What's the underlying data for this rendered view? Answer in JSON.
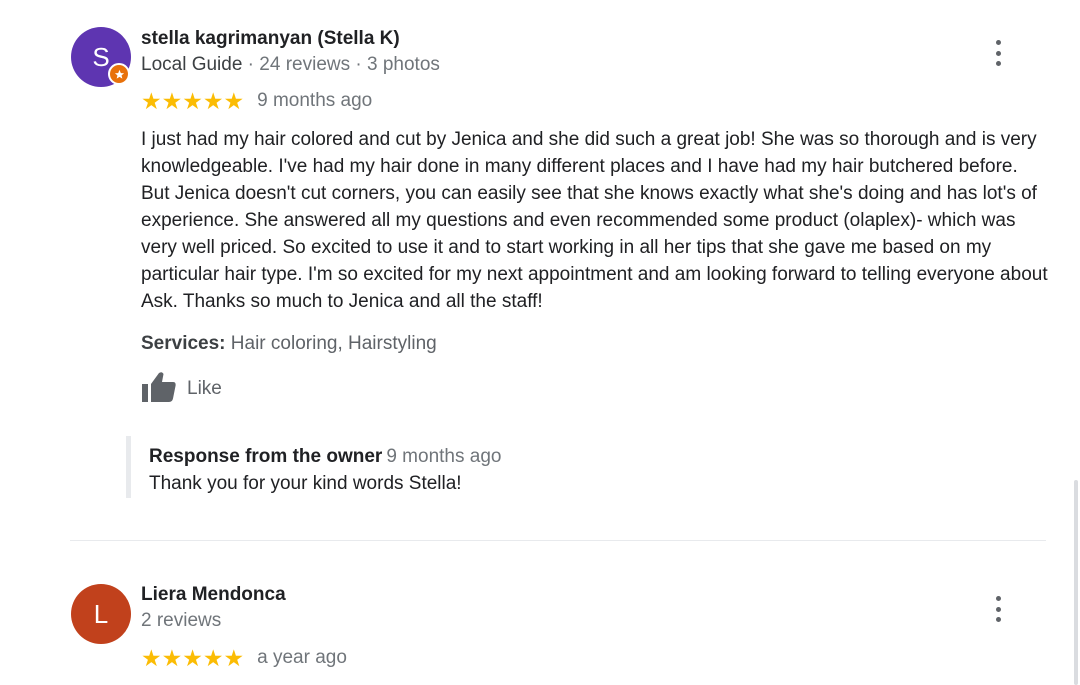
{
  "reviews": [
    {
      "avatar_letter": "S",
      "avatar_color": "#5e35b1",
      "name": "stella kagrimanyan (Stella K)",
      "local_guide": "Local Guide",
      "reviews_count": "24 reviews",
      "photos_count": "3 photos",
      "rating": 5,
      "stars": "★★★★★",
      "time_ago": "9 months ago",
      "text": "I just had my hair colored and cut by Jenica and she did such a great job! She was so thorough and is very knowledgeable. I've had my hair done in many different places and I have had my hair butchered before. But Jenica doesn't cut corners, you can easily see that she knows exactly what she's doing and has lot's of experience. She answered all my questions and even recommended some product (olaplex)- which was very well priced. So excited to use it and to start working in all her tips that she gave me based on my particular hair type. I'm so excited for my next appointment and am looking forward to telling everyone about Ask. Thanks so much to Jenica and all the staff!",
      "services_label": "Services:",
      "services": "Hair coloring, Hairstyling",
      "like_label": "Like",
      "owner_response": {
        "label": "Response from the owner",
        "time_ago": "9 months ago",
        "text": "Thank you for your kind words Stella!"
      }
    },
    {
      "avatar_letter": "L",
      "avatar_color": "#c1411c",
      "name": "Liera Mendonca",
      "reviews_count": "2 reviews",
      "rating": 5,
      "stars": "★★★★★",
      "time_ago": "a year ago"
    }
  ],
  "icons": {
    "more": "more-vert-icon",
    "like": "thumb-up-icon",
    "local_guide": "local-guide-badge-icon"
  },
  "colors": {
    "star": "#fbbc04",
    "secondary_text": "#70757a"
  }
}
